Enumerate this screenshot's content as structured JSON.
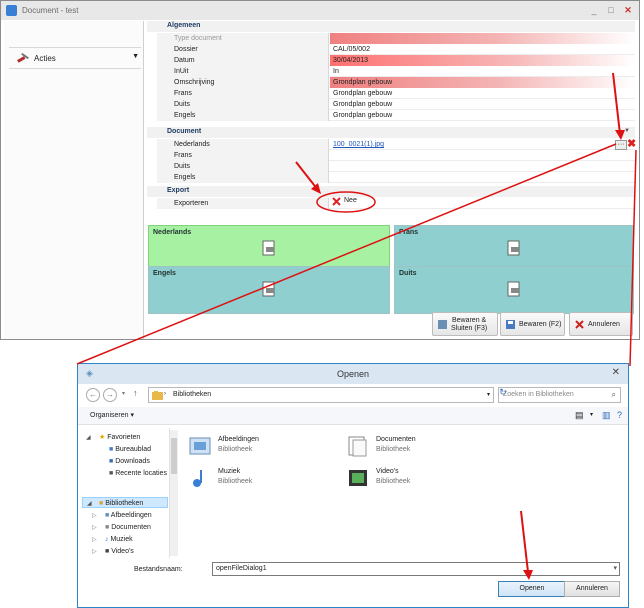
{
  "docwin": {
    "title": "Document - test",
    "minimize": "_",
    "maximize": "□",
    "close": "✕"
  },
  "sidebar": {
    "acties_label": "Acties",
    "dropdown_glyph": "▼"
  },
  "sections": {
    "algemeen": "Algemeen",
    "document": "Document",
    "export": "Export"
  },
  "algemeen_rows": [
    {
      "label": "Type document",
      "value": ""
    },
    {
      "label": "Dossier",
      "value": "CAL/05/002"
    },
    {
      "label": "Datum",
      "value": "30/04/2013"
    },
    {
      "label": "InUit",
      "value": "In"
    },
    {
      "label": "Omschrijving",
      "value": "Grondplan gebouw"
    },
    {
      "label": "Frans",
      "value": "Grondplan gebouw"
    },
    {
      "label": "Duits",
      "value": "Grondplan gebouw"
    },
    {
      "label": "Engels",
      "value": "Grondplan gebouw"
    }
  ],
  "document_rows": [
    {
      "label": "Nederlands",
      "value": "100_0021(1).jpg"
    },
    {
      "label": "Frans",
      "value": ""
    },
    {
      "label": "Duits",
      "value": ""
    },
    {
      "label": "Engels",
      "value": ""
    }
  ],
  "export_rows": [
    {
      "label": "Exporteren",
      "value": "Nee"
    }
  ],
  "panels": {
    "nederlands": "Nederlands",
    "frans": "Frans",
    "engels": "Engels",
    "duits": "Duits"
  },
  "buttons": {
    "bewaren_sluiten_1": "Bewaren &",
    "bewaren_sluiten_2": "Sluiten (F3)",
    "bewaren": "Bewaren (F2)",
    "annuleren": "Annuleren"
  },
  "dialog": {
    "title": "Openen",
    "address": "Bibliotheken",
    "search_placeholder": "Zoeken in Bibliotheken",
    "organiseren": "Organiseren ▾",
    "tree": {
      "favorieten": "Favorieten",
      "bureaublad": "Bureaublad",
      "downloads": "Downloads",
      "recente": "Recente locaties",
      "bibliotheken": "Bibliotheken",
      "afbeeldingen": "Afbeeldingen",
      "documenten": "Documenten",
      "muziek": "Muziek",
      "videos": "Video's"
    },
    "libraries": [
      {
        "name": "Afbeeldingen",
        "sub": "Bibliotheek"
      },
      {
        "name": "Documenten",
        "sub": "Bibliotheek"
      },
      {
        "name": "Muziek",
        "sub": "Bibliotheek"
      },
      {
        "name": "Video's",
        "sub": "Bibliotheek"
      }
    ],
    "filename_label": "Bestandsnaam:",
    "filename_value": "openFileDialog1",
    "open_button": "Openen",
    "cancel_button": "Annuleren"
  },
  "colors": {
    "accent": "#2d84c7",
    "panel_green": "#a6f2a2",
    "panel_teal": "#8fcfcf",
    "annotation_red": "#dd1111"
  }
}
